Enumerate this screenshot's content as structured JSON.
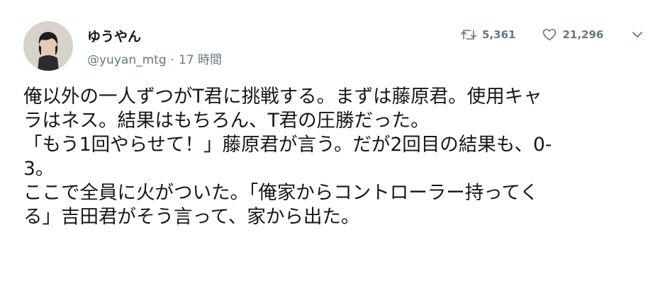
{
  "user": {
    "display_name": "ゆうやん",
    "handle": "@yuyan_mtg",
    "separator": "·",
    "time": "17 時間"
  },
  "actions": {
    "retweet_count": "5,361",
    "like_count": "21,296",
    "retweet_icon": "retweet-icon",
    "like_icon": "heart-icon",
    "more_icon": "chevron-down-icon"
  },
  "tweet": {
    "lines": [
      "俺以外の一人ずつがT君に挑戦する。まずは藤原君。使用キャ",
      "ラはネス。結果はもちろん、T君の圧勝だった。",
      "「もう1回やらせて！」藤原君が言う。だが2回目の結果も、0-",
      "3。",
      "ここで全員に火がついた。「俺家からコントローラー持ってく",
      "る」吉田君がそう言って、家から出た。"
    ]
  },
  "colors": {
    "text": "#14171a",
    "muted": "#657786"
  }
}
